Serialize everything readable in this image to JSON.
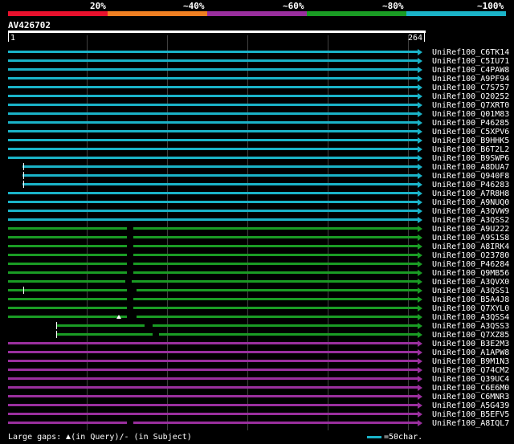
{
  "legend": {
    "labels": [
      "20%",
      "~40%",
      "~60%",
      "~80%",
      "~100%"
    ],
    "colors": [
      "#e8112d",
      "#ef7f22",
      "#9a2f9e",
      "#1a9c24",
      "#1ab3c8"
    ]
  },
  "query": {
    "id": "AV426702",
    "start": "1",
    "end": "264"
  },
  "hits": [
    {
      "name": "UniRef100_C6TK14",
      "color": "#1ab3c8"
    },
    {
      "name": "UniRef100_C5IU71",
      "color": "#1ab3c8"
    },
    {
      "name": "UniRef100_C4PAW8",
      "color": "#1ab3c8"
    },
    {
      "name": "UniRef100_A9PF94",
      "color": "#1ab3c8"
    },
    {
      "name": "UniRef100_C7S757",
      "color": "#1ab3c8"
    },
    {
      "name": "UniRef100_O20252",
      "color": "#1ab3c8"
    },
    {
      "name": "UniRef100_Q7XRT0",
      "color": "#1ab3c8"
    },
    {
      "name": "UniRef100_Q01M83",
      "color": "#1ab3c8"
    },
    {
      "name": "UniRef100_P46285",
      "color": "#1ab3c8"
    },
    {
      "name": "UniRef100_C5XPV6",
      "color": "#1ab3c8"
    },
    {
      "name": "UniRef100_B9HHK5",
      "color": "#1ab3c8"
    },
    {
      "name": "UniRef100_B6T2L2",
      "color": "#1ab3c8"
    },
    {
      "name": "UniRef100_B9SWP6",
      "color": "#1ab3c8"
    },
    {
      "name": "UniRef100_A8DUA7",
      "color": "#1ab3c8"
    },
    {
      "name": "UniRef100_Q940F8",
      "color": "#1ab3c8"
    },
    {
      "name": "UniRef100_P46283",
      "color": "#1ab3c8"
    },
    {
      "name": "UniRef100_A7R8H8",
      "color": "#1ab3c8"
    },
    {
      "name": "UniRef100_A9NUQ0",
      "color": "#1ab3c8"
    },
    {
      "name": "UniRef100_A3QVW9",
      "color": "#1ab3c8"
    },
    {
      "name": "UniRef100_A3QSS2",
      "color": "#1ab3c8"
    },
    {
      "name": "UniRef100_A9U222",
      "color": "#1a9c24"
    },
    {
      "name": "UniRef100_A9S1S8",
      "color": "#1a9c24"
    },
    {
      "name": "UniRef100_A8IRK4",
      "color": "#1a9c24"
    },
    {
      "name": "UniRef100_O23780",
      "color": "#1a9c24"
    },
    {
      "name": "UniRef100_P46284",
      "color": "#1a9c24"
    },
    {
      "name": "UniRef100_Q9MB56",
      "color": "#1a9c24"
    },
    {
      "name": "UniRef100_A3QVX0",
      "color": "#1a9c24"
    },
    {
      "name": "UniRef100_A3QSS1",
      "color": "#1a9c24"
    },
    {
      "name": "UniRef100_B5A4J8",
      "color": "#1a9c24"
    },
    {
      "name": "UniRef100_Q7XYL0",
      "color": "#1a9c24"
    },
    {
      "name": "UniRef100_A3QSS4",
      "color": "#1a9c24"
    },
    {
      "name": "UniRef100_A3QSS3",
      "color": "#1a9c24"
    },
    {
      "name": "UniRef100_Q7XZ85",
      "color": "#1a9c24"
    },
    {
      "name": "UniRef100_B3E2M3",
      "color": "#9a2f9e"
    },
    {
      "name": "UniRef100_A1APW8",
      "color": "#9a2f9e"
    },
    {
      "name": "UniRef100_B9M1N3",
      "color": "#9a2f9e"
    },
    {
      "name": "UniRef100_Q74CM2",
      "color": "#9a2f9e"
    },
    {
      "name": "UniRef100_Q39UC4",
      "color": "#9a2f9e"
    },
    {
      "name": "UniRef100_C6E6M0",
      "color": "#9a2f9e"
    },
    {
      "name": "UniRef100_C6MNR3",
      "color": "#9a2f9e"
    },
    {
      "name": "UniRef100_A5G439",
      "color": "#9a2f9e"
    },
    {
      "name": "UniRef100_B5EFV5",
      "color": "#9a2f9e"
    },
    {
      "name": "UniRef100_A8IQL7",
      "color": "#9a2f9e"
    }
  ],
  "footer": {
    "gaps_text": "Large gaps:",
    "query_text": "(in Query)/- (in Subject)",
    "scale_text": "=50char."
  }
}
